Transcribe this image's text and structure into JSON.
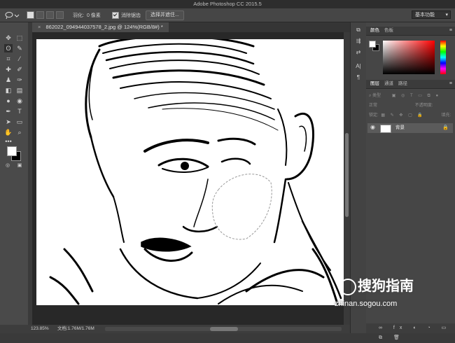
{
  "app": {
    "title": "Adobe Photoshop CC 2015.5"
  },
  "options": {
    "feather_label": "羽化:",
    "feather_value": "0 像素",
    "antialias_label": "消除锯齿",
    "select_mask_button": "选择并遮住...",
    "workspace": "基本功能"
  },
  "document": {
    "tab_title": "862022_094944037578_2.jpg @ 124%(RGB/8#) *",
    "close": "×"
  },
  "status": {
    "zoom": "123.85%",
    "doc_size": "文档:1.76M/1.76M"
  },
  "color_panel": {
    "tab_color": "颜色",
    "tab_swatches": "色板"
  },
  "layers_panel": {
    "tab_layers": "图层",
    "tab_channels": "通道",
    "tab_paths": "路径",
    "kind": "类型",
    "blend_mode": "正常",
    "opacity_label": "不透明度:",
    "lock_label": "锁定:",
    "fill_label": "填充:",
    "layer_name": "背景"
  },
  "watermark": {
    "brand": "搜狗指南",
    "url": "zhinan.sogou.com"
  }
}
